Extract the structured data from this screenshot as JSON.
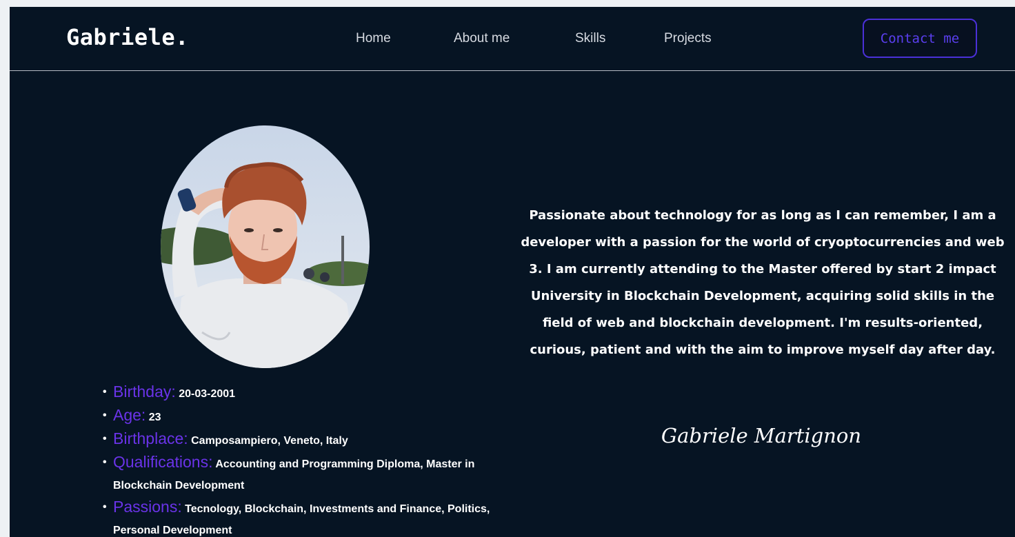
{
  "nav": {
    "logo": "Gabriele.",
    "links": [
      "Home",
      "About me",
      "Skills",
      "Projects"
    ],
    "contact_label": "Contact me"
  },
  "profile": {
    "photo": "profile-photo",
    "details": [
      {
        "key": "Birthday:",
        "value": "20-03-2001"
      },
      {
        "key": "Age:",
        "value": "23"
      },
      {
        "key": "Birthplace:",
        "value": "Camposampiero, Veneto, Italy"
      },
      {
        "key": "Qualifications:",
        "value": "Accounting and Programming Diploma, Master in Blockchain Development"
      },
      {
        "key": "Passions:",
        "value": "Tecnology, Blockchain, Investments and Finance, Politics, Personal Development"
      }
    ]
  },
  "bio": {
    "text": "Passionate about technology for as long as I can remember, I am a developer with a passion for the world of cryoptocurrencies and web 3. I am currently attending to the Master offered by start 2 impact University in Blockchain Development, acquiring solid skills in the field of web and blockchain development. I'm results-oriented, curious, patient and with the aim to improve myself day after day.",
    "signature": "Gabriele Martignon"
  },
  "colors": {
    "background": "#061423",
    "accent": "#6a33e8",
    "button_border": "#4b30d8"
  }
}
